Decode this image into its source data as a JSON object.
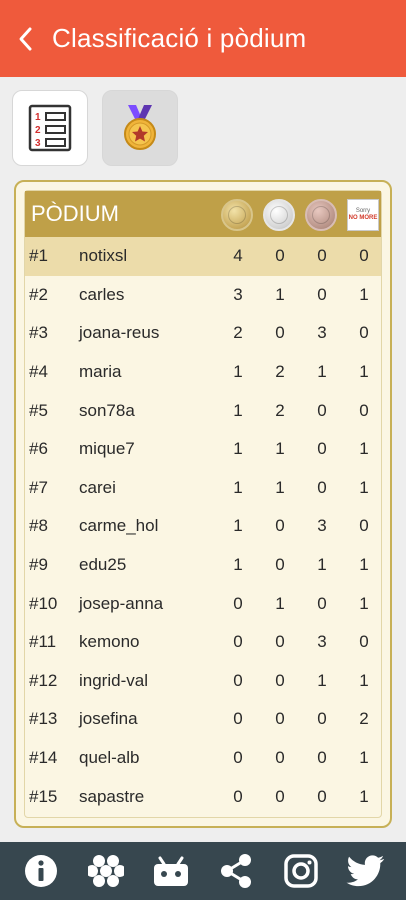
{
  "appbar": {
    "title": "Classificació i pòdium"
  },
  "tabs": [
    {
      "name": "ranking-list",
      "icon": "numbered-list-icon"
    },
    {
      "name": "podium",
      "icon": "medal-icon"
    }
  ],
  "colors": {
    "appbar": "#ef5a3c",
    "header": "#bfa048",
    "panel": "#fbf6e3",
    "bottombar": "#37474f"
  },
  "podium": {
    "title": "PÒDIUM",
    "columns": [
      "gold-medal",
      "silver-medal",
      "bronze-medal",
      "sorry-card"
    ],
    "sorry_text": [
      "Sorry",
      "NO MORE"
    ],
    "rows": [
      {
        "rank": "#1",
        "name": "notixsl",
        "v": [
          "4",
          "0",
          "0",
          "0"
        ]
      },
      {
        "rank": "#2",
        "name": "carles",
        "v": [
          "3",
          "1",
          "0",
          "1"
        ]
      },
      {
        "rank": "#3",
        "name": "joana-reus",
        "v": [
          "2",
          "0",
          "3",
          "0"
        ]
      },
      {
        "rank": "#4",
        "name": "maria",
        "v": [
          "1",
          "2",
          "1",
          "1"
        ]
      },
      {
        "rank": "#5",
        "name": "son78a",
        "v": [
          "1",
          "2",
          "0",
          "0"
        ]
      },
      {
        "rank": "#6",
        "name": "mique7",
        "v": [
          "1",
          "1",
          "0",
          "1"
        ]
      },
      {
        "rank": "#7",
        "name": "carei",
        "v": [
          "1",
          "1",
          "0",
          "1"
        ]
      },
      {
        "rank": "#8",
        "name": "carme_hol",
        "v": [
          "1",
          "0",
          "3",
          "0"
        ]
      },
      {
        "rank": "#9",
        "name": "edu25",
        "v": [
          "1",
          "0",
          "1",
          "1"
        ]
      },
      {
        "rank": "#10",
        "name": "josep-anna",
        "v": [
          "0",
          "1",
          "0",
          "1"
        ]
      },
      {
        "rank": "#11",
        "name": "kemono",
        "v": [
          "0",
          "0",
          "3",
          "0"
        ]
      },
      {
        "rank": "#12",
        "name": "ingrid-val",
        "v": [
          "0",
          "0",
          "1",
          "1"
        ]
      },
      {
        "rank": "#13",
        "name": "josefina",
        "v": [
          "0",
          "0",
          "0",
          "2"
        ]
      },
      {
        "rank": "#14",
        "name": "quel-alb",
        "v": [
          "0",
          "0",
          "0",
          "1"
        ]
      },
      {
        "rank": "#15",
        "name": "sapastre",
        "v": [
          "0",
          "0",
          "0",
          "1"
        ]
      }
    ]
  },
  "bottom_icons": [
    "info-icon",
    "honeycomb-icon",
    "android-icon",
    "share-icon",
    "instagram-icon",
    "twitter-icon"
  ]
}
